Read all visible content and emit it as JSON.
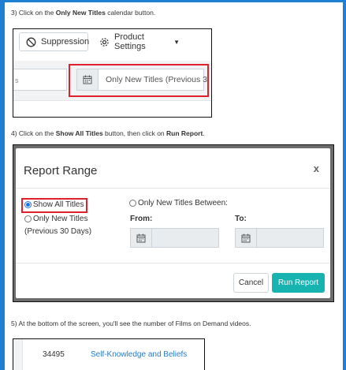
{
  "step3": {
    "prefix": "3) Click on the ",
    "bold": "Only New Titles",
    "suffix": " calendar button."
  },
  "shot1": {
    "suppression_label": "Suppression",
    "product_settings_label": "Product Settings",
    "left_field_text": "s",
    "date_field_text": "Only New Titles (Previous 3"
  },
  "step4": {
    "prefix": "4) Click on the ",
    "bold1": "Show All Titles",
    "middle": " button, then click on ",
    "bold2": "Run Report",
    "suffix": "."
  },
  "modal": {
    "title": "Report Range",
    "close": "x",
    "show_all_label": "Show All Titles",
    "only_new_label": "Only New Titles",
    "only_new_sub": "(Previous 30 Days)",
    "between_label": "Only New Titles Between:",
    "from_label": "From:",
    "to_label": "To:",
    "cancel_label": "Cancel",
    "run_label": "Run Report",
    "selected_option": "Show All Titles"
  },
  "step5": {
    "text": "5) At the bottom of the screen, you'll see the number of Films on Demand videos."
  },
  "shot3": {
    "number": "34495",
    "link": "Self-Knowledge and Beliefs"
  },
  "colors": {
    "accent": "#1f7fd3",
    "highlight": "#e0202a",
    "run_button": "#17b3b0",
    "link": "#2a7ac8"
  },
  "icons": [
    "ban-icon",
    "gear-icon",
    "caret-down-icon",
    "calendar-icon",
    "close-icon"
  ]
}
